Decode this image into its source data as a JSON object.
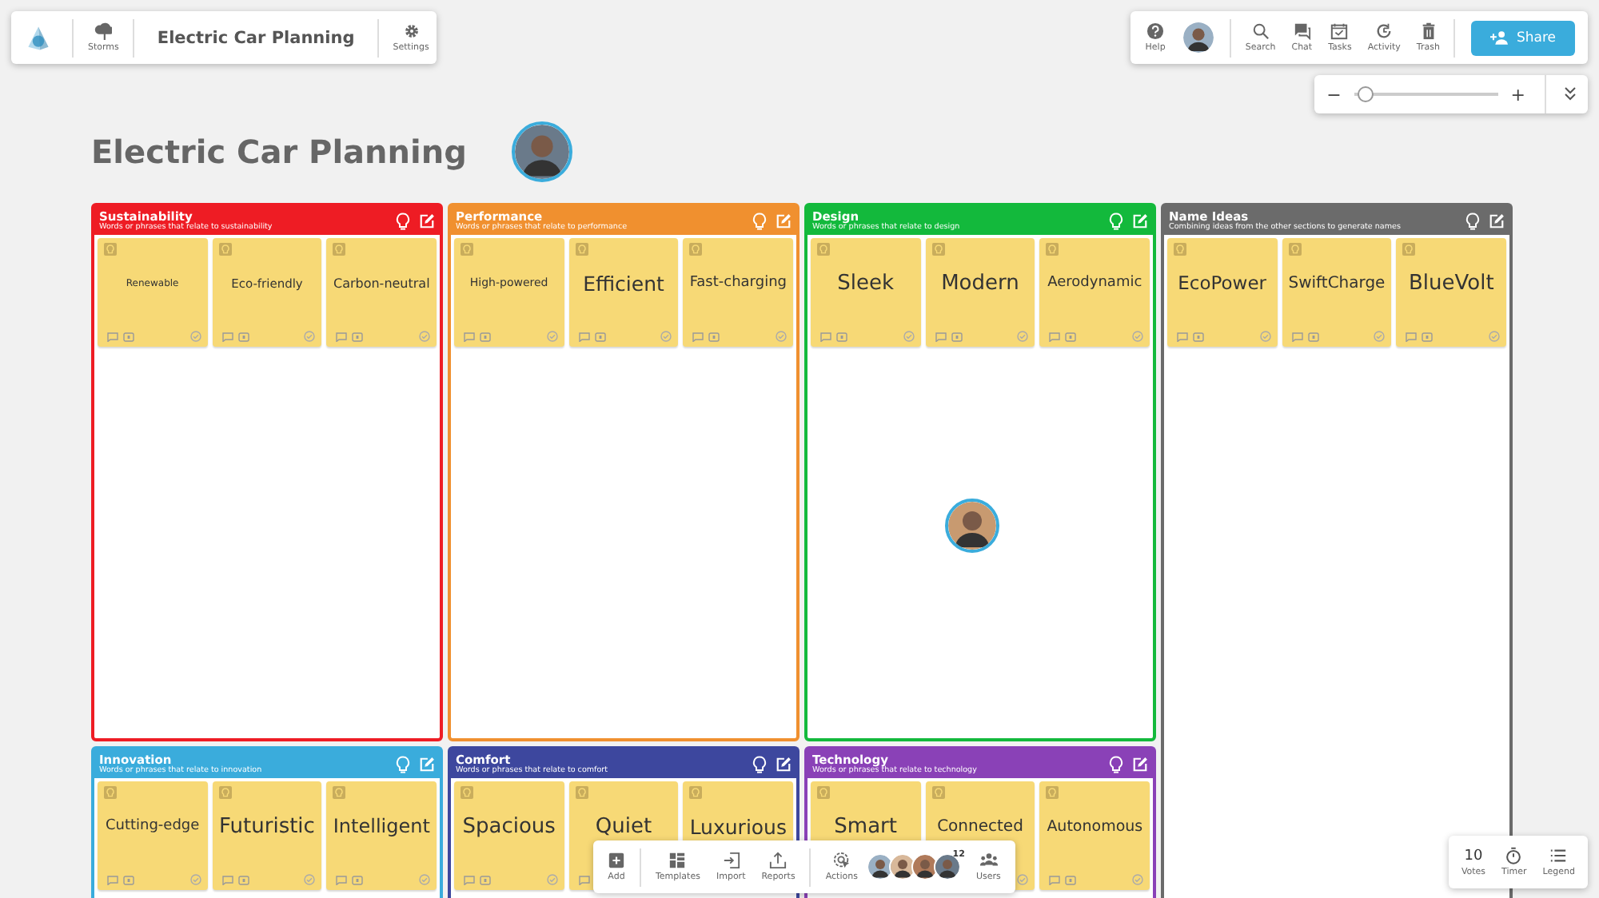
{
  "top_left_bar": {
    "storms": "Storms",
    "title": "Electric Car Planning",
    "settings": "Settings"
  },
  "top_right_bar": {
    "items": [
      "Help",
      "Search",
      "Chat",
      "Tasks",
      "Activity",
      "Trash"
    ],
    "share": "Share"
  },
  "zoom": {
    "minus": "−",
    "plus": "+",
    "level": 0.03
  },
  "board_title": "Electric Car Planning",
  "sections": [
    {
      "title": "Sustainability",
      "subtitle": "Words or phrases that relate to sustainability",
      "color": "#ee1c24",
      "notes": [
        "Renewable",
        "Eco-friendly",
        "Carbon-neutral"
      ]
    },
    {
      "title": "Performance",
      "subtitle": "Words or phrases that relate to performance",
      "color": "#f0902f",
      "notes": [
        "High-powered",
        "Efficient",
        "Fast-charging"
      ]
    },
    {
      "title": "Design",
      "subtitle": "Words or phrases that relate to design",
      "color": "#13b93c",
      "notes": [
        "Sleek",
        "Modern",
        "Aerodynamic"
      ]
    },
    {
      "title": "Name Ideas",
      "subtitle": "Combining ideas from the other sections to generate names",
      "color": "#6b6b6b",
      "notes": [
        "EcoPower",
        "SwiftCharge",
        "BlueVolt"
      ]
    },
    {
      "title": "Innovation",
      "subtitle": "Words or phrases that relate to innovation",
      "color": "#3aacdc",
      "notes": [
        "Cutting-edge",
        "Futuristic",
        "Intelligent"
      ]
    },
    {
      "title": "Comfort",
      "subtitle": "Words or phrases that relate to comfort",
      "color": "#3d479e",
      "notes": [
        "Spacious",
        "Quiet",
        "Luxurious"
      ]
    },
    {
      "title": "Technology",
      "subtitle": "Words or phrases that relate to technology",
      "color": "#8a41b7",
      "notes": [
        "Smart",
        "Connected",
        "Autonomous"
      ]
    }
  ],
  "bottom_toolbar": {
    "items": [
      "Add",
      "Templates",
      "Import",
      "Reports",
      "Actions"
    ],
    "user_count": "12",
    "users": "Users"
  },
  "bottom_right_bar": {
    "votes_count": "10",
    "votes": "Votes",
    "timer": "Timer",
    "legend": "Legend"
  }
}
